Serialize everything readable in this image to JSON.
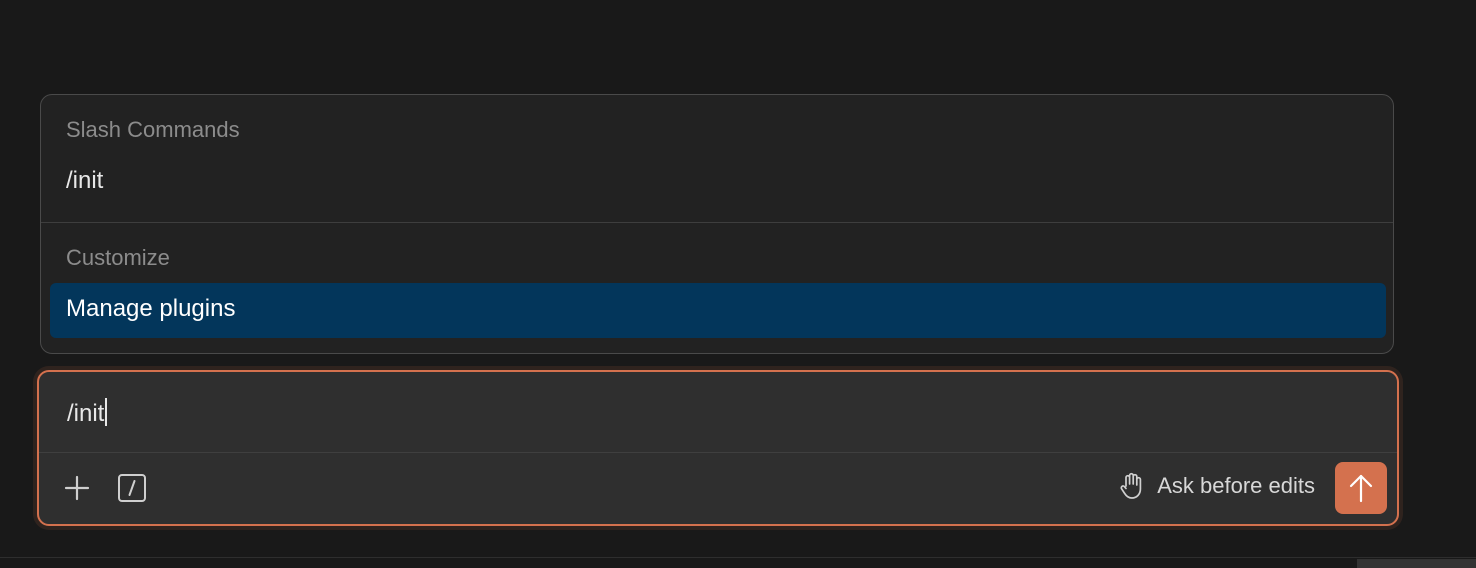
{
  "popup": {
    "sections": [
      {
        "title": "Slash Commands",
        "items": [
          "/init"
        ]
      },
      {
        "title": "Customize",
        "items": [
          "Manage plugins"
        ]
      }
    ],
    "selected_item": "Manage plugins"
  },
  "composer": {
    "value": "/init",
    "add_icon": "plus-icon",
    "slash_icon": "slash-command-icon",
    "mode_icon": "hand-icon",
    "mode_label": "Ask before edits",
    "send_icon": "arrow-up-icon"
  },
  "colors": {
    "accent": "#d4714e",
    "selected_bg": "#03365b",
    "background": "#191919"
  }
}
